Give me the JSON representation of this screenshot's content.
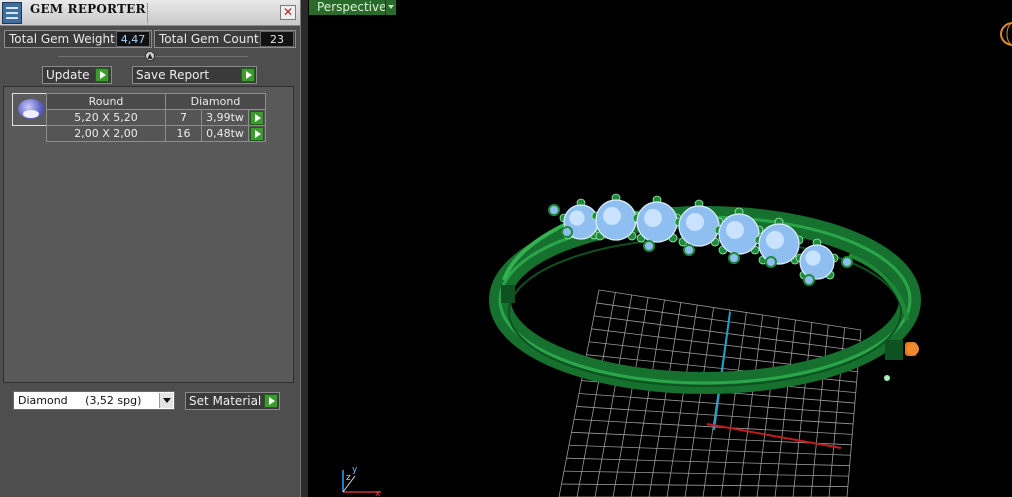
{
  "window": {
    "title": "GEM REPORTER",
    "close_label": "✕"
  },
  "stats": {
    "weight_label": "Total Gem Weight",
    "weight_value": "4,47",
    "count_label": "Total Gem Count",
    "count_value": "23"
  },
  "actions": {
    "update_label": "Update",
    "save_report_label": "Save Report"
  },
  "gem_table": {
    "headers": [
      "Round",
      "Diamond"
    ],
    "rows": [
      {
        "size": "5,20 X 5,20",
        "count": "7",
        "weight": "3,99tw"
      },
      {
        "size": "2,00 X 2,00",
        "count": "16",
        "weight": "0,48tw"
      }
    ]
  },
  "material": {
    "selected": "Diamond     (3,52 spg)",
    "set_label": "Set Material"
  },
  "viewport": {
    "view_label": "Perspective",
    "axis_x": "x",
    "axis_y": "y",
    "axis_z": "z"
  },
  "colors": {
    "metal": "#1f8a3a",
    "gem": "#8fbff0",
    "grid": "#a9a9a9",
    "panel": "#4e4e4e",
    "accent_green": "#3c9b2e"
  }
}
